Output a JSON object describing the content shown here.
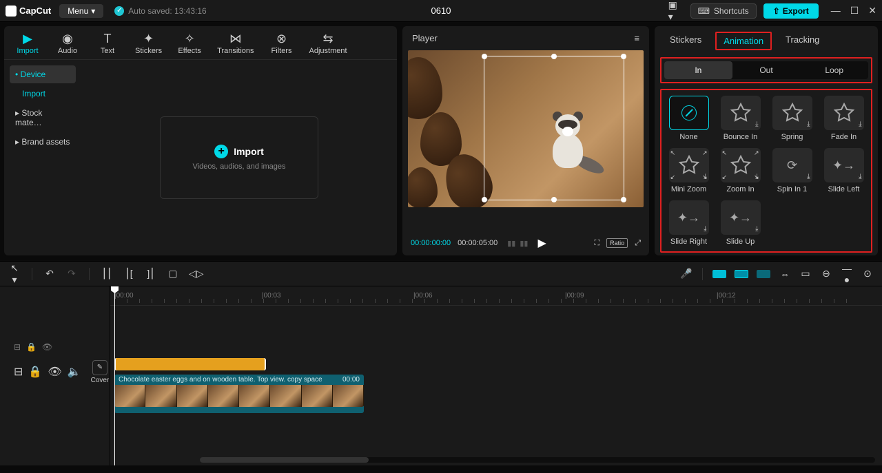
{
  "titlebar": {
    "logo": "CapCut",
    "menu": "Menu",
    "autosave": "Auto saved: 13:43:16",
    "project": "0610",
    "shortcuts": "Shortcuts",
    "export": "Export"
  },
  "tools": {
    "items": [
      {
        "label": "Import",
        "icon": "▶"
      },
      {
        "label": "Audio",
        "icon": "◉"
      },
      {
        "label": "Text",
        "icon": "T"
      },
      {
        "label": "Stickers",
        "icon": "✦"
      },
      {
        "label": "Effects",
        "icon": "✧"
      },
      {
        "label": "Transitions",
        "icon": "⋈"
      },
      {
        "label": "Filters",
        "icon": "⊗"
      },
      {
        "label": "Adjustment",
        "icon": "⇆"
      }
    ]
  },
  "sideNav": {
    "items": [
      {
        "label": "• Device",
        "active": true
      },
      {
        "label": "Import",
        "sub": true
      },
      {
        "label": "▸ Stock mate…"
      },
      {
        "label": "▸ Brand assets"
      }
    ]
  },
  "importBox": {
    "title": "Import",
    "sub": "Videos, audios, and images"
  },
  "player": {
    "title": "Player",
    "current": "00:00:00:00",
    "duration": "00:00:05:00",
    "ratio": "Ratio"
  },
  "rightPanel": {
    "tabs": [
      {
        "label": "Stickers"
      },
      {
        "label": "Animation",
        "active": true
      },
      {
        "label": "Tracking"
      }
    ],
    "subTabs": [
      {
        "label": "In",
        "active": true
      },
      {
        "label": "Out"
      },
      {
        "label": "Loop"
      }
    ],
    "animations": [
      {
        "label": "None",
        "selected": true,
        "type": "none"
      },
      {
        "label": "Bounce In",
        "type": "star"
      },
      {
        "label": "Spring",
        "type": "star"
      },
      {
        "label": "Fade In",
        "type": "star"
      },
      {
        "label": "Mini Zoom",
        "type": "star-arrows"
      },
      {
        "label": "Zoom In",
        "type": "star-arrows"
      },
      {
        "label": "Spin In 1",
        "type": "spin"
      },
      {
        "label": "Slide Left",
        "type": "slide"
      },
      {
        "label": "Slide Right",
        "type": "slide"
      },
      {
        "label": "Slide Up",
        "type": "slide"
      }
    ]
  },
  "timeline": {
    "ruler": [
      {
        "label": "|00:00",
        "pos": 6
      },
      {
        "label": "|00:03",
        "pos": 220
      },
      {
        "label": "|00:06",
        "pos": 440
      },
      {
        "label": "|00:09",
        "pos": 660
      },
      {
        "label": "|00:12",
        "pos": 880
      }
    ],
    "clip": {
      "label": "Chocolate easter eggs and on wooden table. Top view. copy space",
      "time": "00:00"
    },
    "cover": "Cover"
  }
}
